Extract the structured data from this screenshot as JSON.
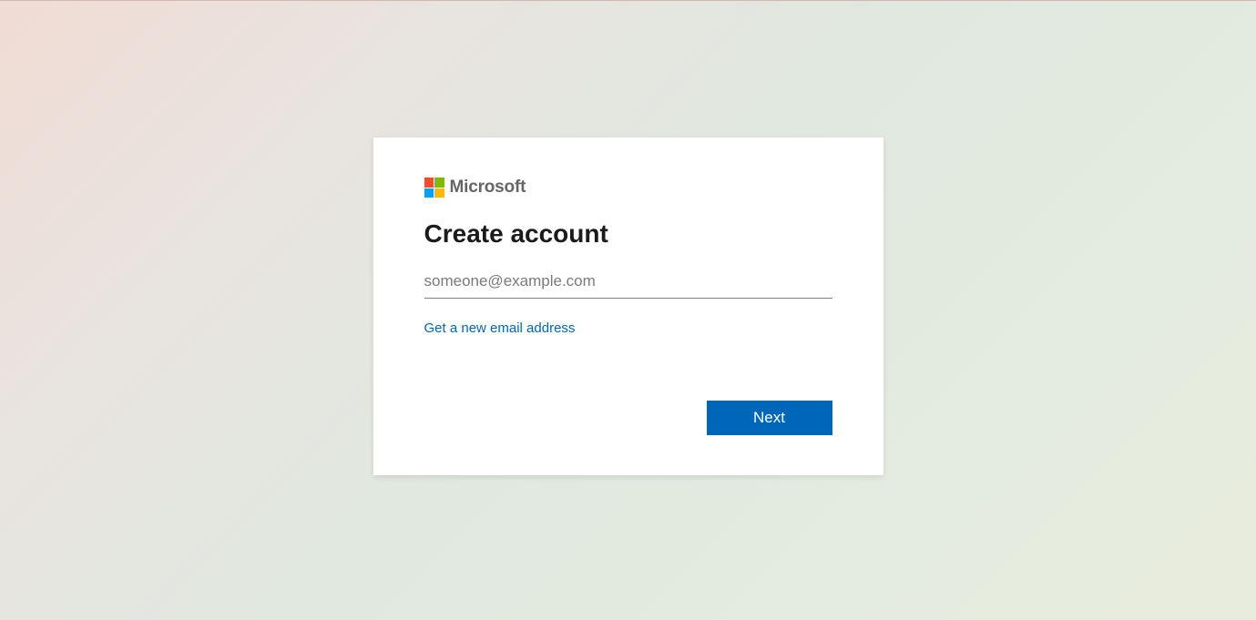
{
  "brand": {
    "name": "Microsoft"
  },
  "form": {
    "heading": "Create account",
    "email_placeholder": "someone@example.com",
    "new_email_link": "Get a new email address",
    "next_button": "Next"
  },
  "colors": {
    "primary": "#0067b8",
    "logo_red": "#f25022",
    "logo_green": "#7fba00",
    "logo_blue": "#00a4ef",
    "logo_yellow": "#ffb900"
  }
}
